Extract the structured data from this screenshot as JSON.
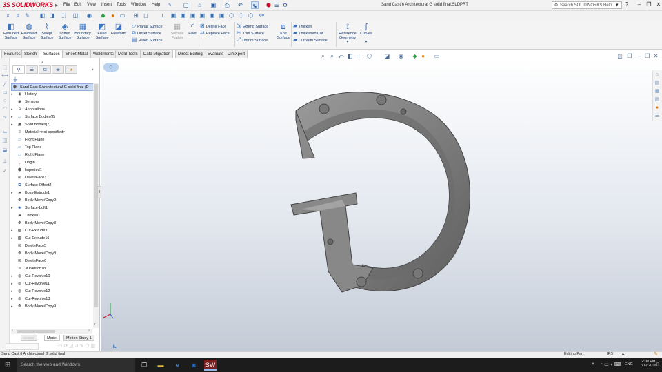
{
  "app": {
    "logo": "SOLIDWORKS",
    "logo_prefix": "3S",
    "document_title": "Sand Cast 6 Architectural G solid final.SLDPRT",
    "search_placeholder": "Search SOLIDWORKS Help",
    "accent_color": "#c8102e"
  },
  "menu": [
    "File",
    "Edit",
    "View",
    "Insert",
    "Tools",
    "Window",
    "Help"
  ],
  "ribbon": {
    "big_buttons": [
      {
        "label": "Extruded Surface",
        "icon": "extruded-surface-icon"
      },
      {
        "label": "Revolved Surface",
        "icon": "revolved-surface-icon"
      },
      {
        "label": "Swept Surface",
        "icon": "swept-surface-icon"
      },
      {
        "label": "Lofted Surface",
        "icon": "lofted-surface-icon"
      },
      {
        "label": "Boundary Surface",
        "icon": "boundary-surface-icon"
      },
      {
        "label": "Filled Surface",
        "icon": "filled-surface-icon"
      },
      {
        "label": "Freeform",
        "icon": "freeform-icon"
      }
    ],
    "col1": [
      "Planar Surface",
      "Offset Surface",
      "Ruled Surface"
    ],
    "flatten": "Surface Flatten",
    "fillet": "Fillet",
    "col2": [
      "Delete Face",
      "Replace Face"
    ],
    "col3": [
      "Extend Surface",
      "Trim Surface",
      "Untrim Surface"
    ],
    "knit": "Knit Surface",
    "col4": [
      "Thicken",
      "Thickened Cut",
      "Cut With Surface"
    ],
    "reference_geometry": "Reference Geometry",
    "curves": "Curves"
  },
  "tabs": [
    "Features",
    "Sketch",
    "Surfaces",
    "Sheet Metal",
    "Weldments",
    "Mold Tools",
    "Data Migration",
    "Direct Editing",
    "Evaluate",
    "DimXpert"
  ],
  "active_tab": "Surfaces",
  "tree": {
    "root": "Sand Cast 6 Architectural G solid final  (D",
    "items": [
      {
        "label": "History",
        "expandable": true,
        "icon": "history-icon"
      },
      {
        "label": "Sensors",
        "expandable": false,
        "icon": "sensor-icon"
      },
      {
        "label": "Annotations",
        "expandable": true,
        "icon": "annotations-icon"
      },
      {
        "label": "Surface Bodies(2)",
        "expandable": true,
        "icon": "surface-bodies-icon"
      },
      {
        "label": "Solid Bodies(7)",
        "expandable": true,
        "icon": "solid-bodies-icon"
      },
      {
        "label": "Material <not specified>",
        "expandable": false,
        "icon": "material-icon"
      },
      {
        "label": "Front Plane",
        "expandable": false,
        "icon": "plane-icon"
      },
      {
        "label": "Top Plane",
        "expandable": false,
        "icon": "plane-icon"
      },
      {
        "label": "Right Plane",
        "expandable": false,
        "icon": "plane-icon"
      },
      {
        "label": "Origin",
        "expandable": false,
        "icon": "origin-icon"
      },
      {
        "label": "Imported1",
        "expandable": false,
        "icon": "imported-icon"
      },
      {
        "label": "DeleteFace3",
        "expandable": false,
        "icon": "delete-face-icon"
      },
      {
        "label": "Surface-Offset2",
        "expandable": false,
        "icon": "surface-offset-icon"
      },
      {
        "label": "Boss-Extrude1",
        "expandable": true,
        "icon": "boss-extrude-icon"
      },
      {
        "label": "Body-Move/Copy2",
        "expandable": false,
        "icon": "move-copy-icon"
      },
      {
        "label": "Surface-Loft1",
        "expandable": true,
        "icon": "surface-loft-icon"
      },
      {
        "label": "Thicken1",
        "expandable": false,
        "icon": "thicken-icon"
      },
      {
        "label": "Body-Move/Copy3",
        "expandable": false,
        "icon": "move-copy-icon"
      },
      {
        "label": "Cut-Extrude3",
        "expandable": true,
        "icon": "cut-extrude-icon"
      },
      {
        "label": "Cut-Extrude16",
        "expandable": true,
        "icon": "cut-extrude-icon"
      },
      {
        "label": "DeleteFace5",
        "expandable": false,
        "icon": "delete-face-icon"
      },
      {
        "label": "Body-Move/Copy8",
        "expandable": false,
        "icon": "move-copy-icon"
      },
      {
        "label": "DeleteFace6",
        "expandable": false,
        "icon": "delete-face-icon"
      },
      {
        "label": "3DSketch18",
        "expandable": false,
        "icon": "sketch-3d-icon"
      },
      {
        "label": "Cut-Revolve10",
        "expandable": true,
        "icon": "cut-revolve-icon"
      },
      {
        "label": "Cut-Revolve11",
        "expandable": true,
        "icon": "cut-revolve-icon"
      },
      {
        "label": "Cut-Revolve12",
        "expandable": true,
        "icon": "cut-revolve-icon"
      },
      {
        "label": "Cut-Revolve13",
        "expandable": true,
        "icon": "cut-revolve-icon"
      },
      {
        "label": "Body-Move/Copy9",
        "expandable": true,
        "icon": "move-copy-icon"
      }
    ]
  },
  "bottom_tabs": [
    "Model",
    "Motion Study 1"
  ],
  "status": {
    "file": "Sand Cast 6 Architectural G solid final",
    "mode": "Editing Part",
    "units": "IPS"
  },
  "taskbar": {
    "search": "Search the web and Windows",
    "time": "2:00 PM",
    "date": "7/12/2016",
    "language": "ENG"
  }
}
